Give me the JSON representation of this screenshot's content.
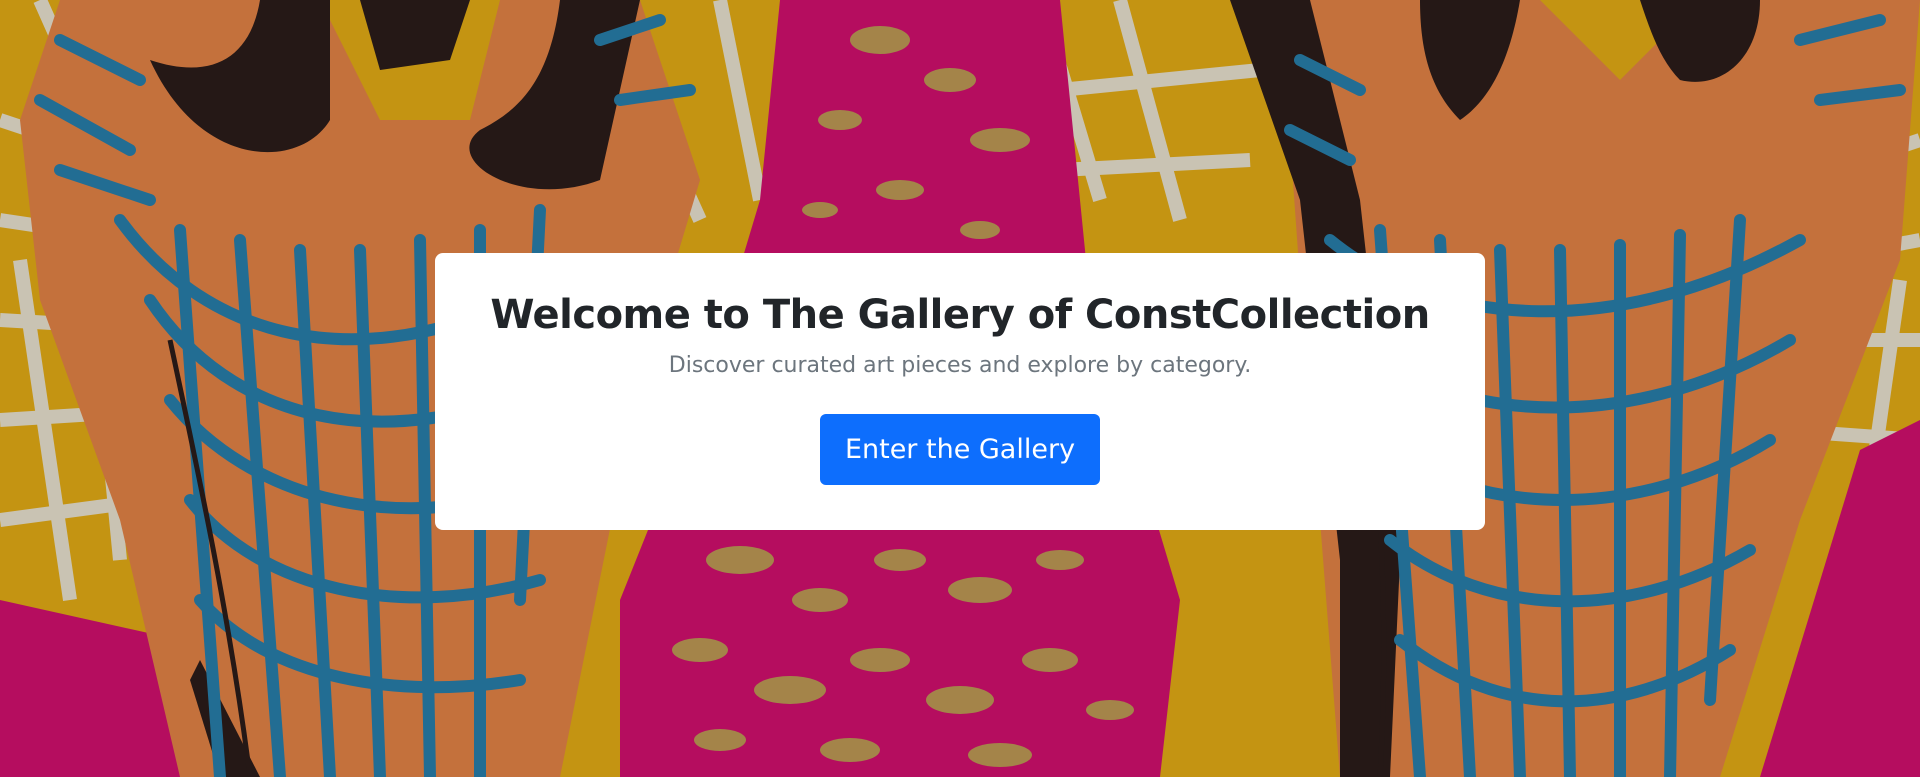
{
  "hero": {
    "background": {
      "description_icon": "painting-background",
      "colors": {
        "yellow": "#f2b818",
        "orange": "#f08a4a",
        "blue": "#2a86b4",
        "magenta": "#dd1175",
        "dark": "#2e1e1c",
        "gold": "#c9a15a"
      }
    },
    "card": {
      "title": "Welcome to The Gallery of ConstCollection",
      "subtitle": "Discover curated art pieces and explore by category.",
      "cta_label": "Enter the Gallery"
    },
    "colors": {
      "primary": "#0d6efd",
      "title": "#212529",
      "muted": "#6c757d",
      "card_bg": "#ffffff"
    }
  }
}
